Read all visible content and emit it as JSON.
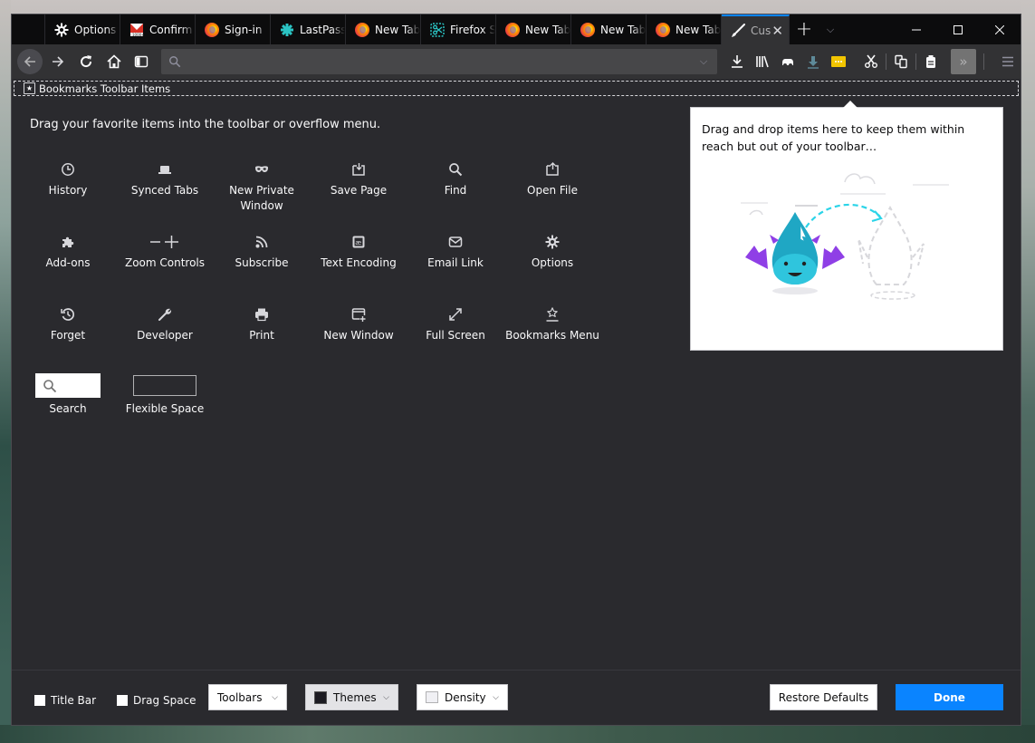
{
  "tabs": [
    {
      "label": "Options",
      "icon": "gear-icon"
    },
    {
      "label": "Confirm",
      "icon": "gmail-icon"
    },
    {
      "label": "Sign-in",
      "icon": "firefox-icon"
    },
    {
      "label": "LastPass",
      "icon": "lastpass-icon"
    },
    {
      "label": "New Tab",
      "icon": "firefox-icon"
    },
    {
      "label": "Firefox Screenshots",
      "icon": "screenshots-icon"
    },
    {
      "label": "New Tab",
      "icon": "firefox-icon"
    },
    {
      "label": "New Tab",
      "icon": "firefox-icon"
    },
    {
      "label": "New Tab",
      "icon": "firefox-icon"
    },
    {
      "label": "Customize Firefox",
      "icon": "paintbrush-icon",
      "active": true
    }
  ],
  "urlbar": {
    "value": "",
    "placeholder": ""
  },
  "bookmarks_toolbar": {
    "label": "Bookmarks Toolbar Items"
  },
  "palette": {
    "heading": "Drag your favorite items into the toolbar or overflow menu.",
    "items": [
      {
        "label": "History",
        "icon": "history-clock-icon"
      },
      {
        "label": "Synced Tabs",
        "icon": "synced-tabs-icon"
      },
      {
        "label": "New Private Window",
        "icon": "private-mask-icon"
      },
      {
        "label": "Save Page",
        "icon": "save-page-icon"
      },
      {
        "label": "Find",
        "icon": "find-magnifier-icon"
      },
      {
        "label": "Open File",
        "icon": "open-file-icon"
      },
      {
        "label": "Add-ons",
        "icon": "puzzle-icon"
      },
      {
        "label": "Zoom Controls",
        "icon": "zoom-controls-icon"
      },
      {
        "label": "Subscribe",
        "icon": "rss-icon"
      },
      {
        "label": "Text Encoding",
        "icon": "text-encoding-icon"
      },
      {
        "label": "Email Link",
        "icon": "envelope-icon"
      },
      {
        "label": "Options",
        "icon": "gear-icon"
      },
      {
        "label": "Forget",
        "icon": "forget-icon"
      },
      {
        "label": "Developer",
        "icon": "wrench-icon"
      },
      {
        "label": "Print",
        "icon": "printer-icon"
      },
      {
        "label": "New Window",
        "icon": "new-window-icon"
      },
      {
        "label": "Full Screen",
        "icon": "fullscreen-icon"
      },
      {
        "label": "Bookmarks Menu",
        "icon": "bookmarks-menu-icon"
      },
      {
        "label": "Search",
        "icon": "search-widget"
      },
      {
        "label": "Flexible Space",
        "icon": "flexible-space-widget"
      }
    ]
  },
  "overflow_panel": {
    "text": "Drag and drop items here to keep them within reach but out of your toolbar…"
  },
  "footer": {
    "title_bar": {
      "label": "Title Bar",
      "checked": false
    },
    "drag_space": {
      "label": "Drag Space",
      "checked": false
    },
    "toolbars": "Toolbars",
    "themes": "Themes",
    "density": "Density",
    "restore_defaults": "Restore Defaults",
    "done": "Done"
  },
  "colors": {
    "accent": "#0a84ff",
    "background": "#2a2a2e",
    "tabstrip": "#0c0c0d"
  }
}
